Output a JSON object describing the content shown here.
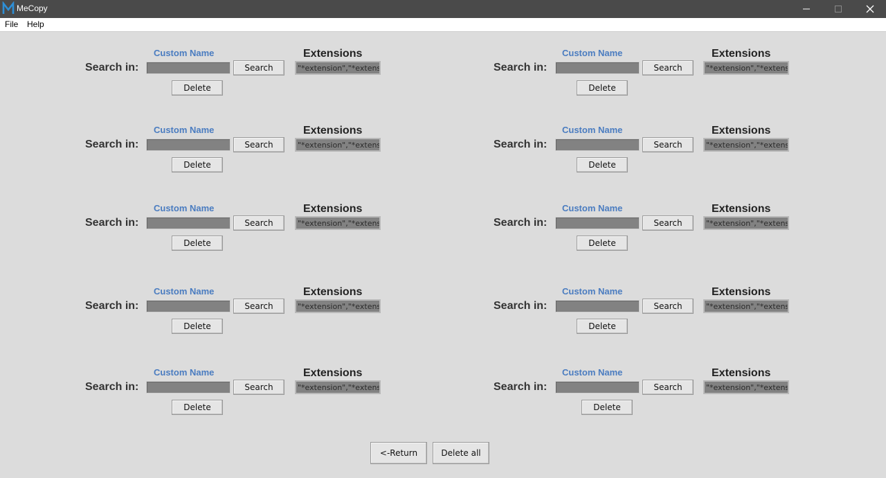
{
  "window": {
    "title": "MeCopy",
    "logo_letter": "M",
    "accent": "#2e8fd6"
  },
  "menu": {
    "items": [
      "File",
      "Help"
    ]
  },
  "labels": {
    "custom_name": "Custom Name",
    "extensions": "Extensions",
    "search_in": "Search in:",
    "search_button": "Search",
    "delete_button": "Delete",
    "extensions_value": "\"*extension\",\"*extension\""
  },
  "rows": [
    {
      "path": "",
      "extensions": "\"*extension\",\"*extension\""
    },
    {
      "path": "",
      "extensions": "\"*extension\",\"*extension\""
    },
    {
      "path": "",
      "extensions": "\"*extension\",\"*extension\""
    },
    {
      "path": "",
      "extensions": "\"*extension\",\"*extension\""
    },
    {
      "path": "",
      "extensions": "\"*extension\",\"*extension\""
    },
    {
      "path": "",
      "extensions": "\"*extension\",\"*extension\""
    },
    {
      "path": "",
      "extensions": "\"*extension\",\"*extension\""
    },
    {
      "path": "",
      "extensions": "\"*extension\",\"*extension\""
    },
    {
      "path": "",
      "extensions": "\"*extension\",\"*extension\""
    },
    {
      "path": "",
      "extensions": "\"*extension\",\"*extension\""
    }
  ],
  "footer": {
    "return_label": "<-Return",
    "delete_all_label": "Delete all"
  }
}
